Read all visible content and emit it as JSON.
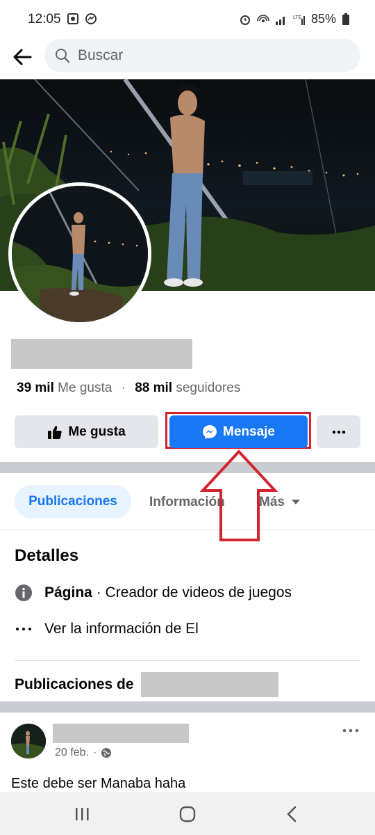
{
  "status_bar": {
    "time": "12:05",
    "battery": "85%"
  },
  "search": {
    "placeholder": "Buscar"
  },
  "profile": {
    "likes_count": "39 mil",
    "likes_label": "Me gusta",
    "dot": "·",
    "followers_count": "88 mil",
    "followers_label": "seguidores"
  },
  "actions": {
    "like_label": "Me gusta",
    "message_label": "Mensaje"
  },
  "tabs": [
    {
      "label": "Publicaciones",
      "active": true
    },
    {
      "label": "Información",
      "active": false
    },
    {
      "label": "Más",
      "active": false
    }
  ],
  "details": {
    "title": "Detalles",
    "page_label": "Página",
    "page_category": " · Creador de videos de juegos",
    "see_info": "Ver la información de El"
  },
  "posts": {
    "header": "Publicaciones de",
    "date": "20 feb.",
    "dot": "·",
    "text": "Este debe ser Manaba haha"
  },
  "colors": {
    "accent": "#1877f2",
    "highlight": "#d2242f",
    "tab_active_bg": "#e7f3ff"
  }
}
